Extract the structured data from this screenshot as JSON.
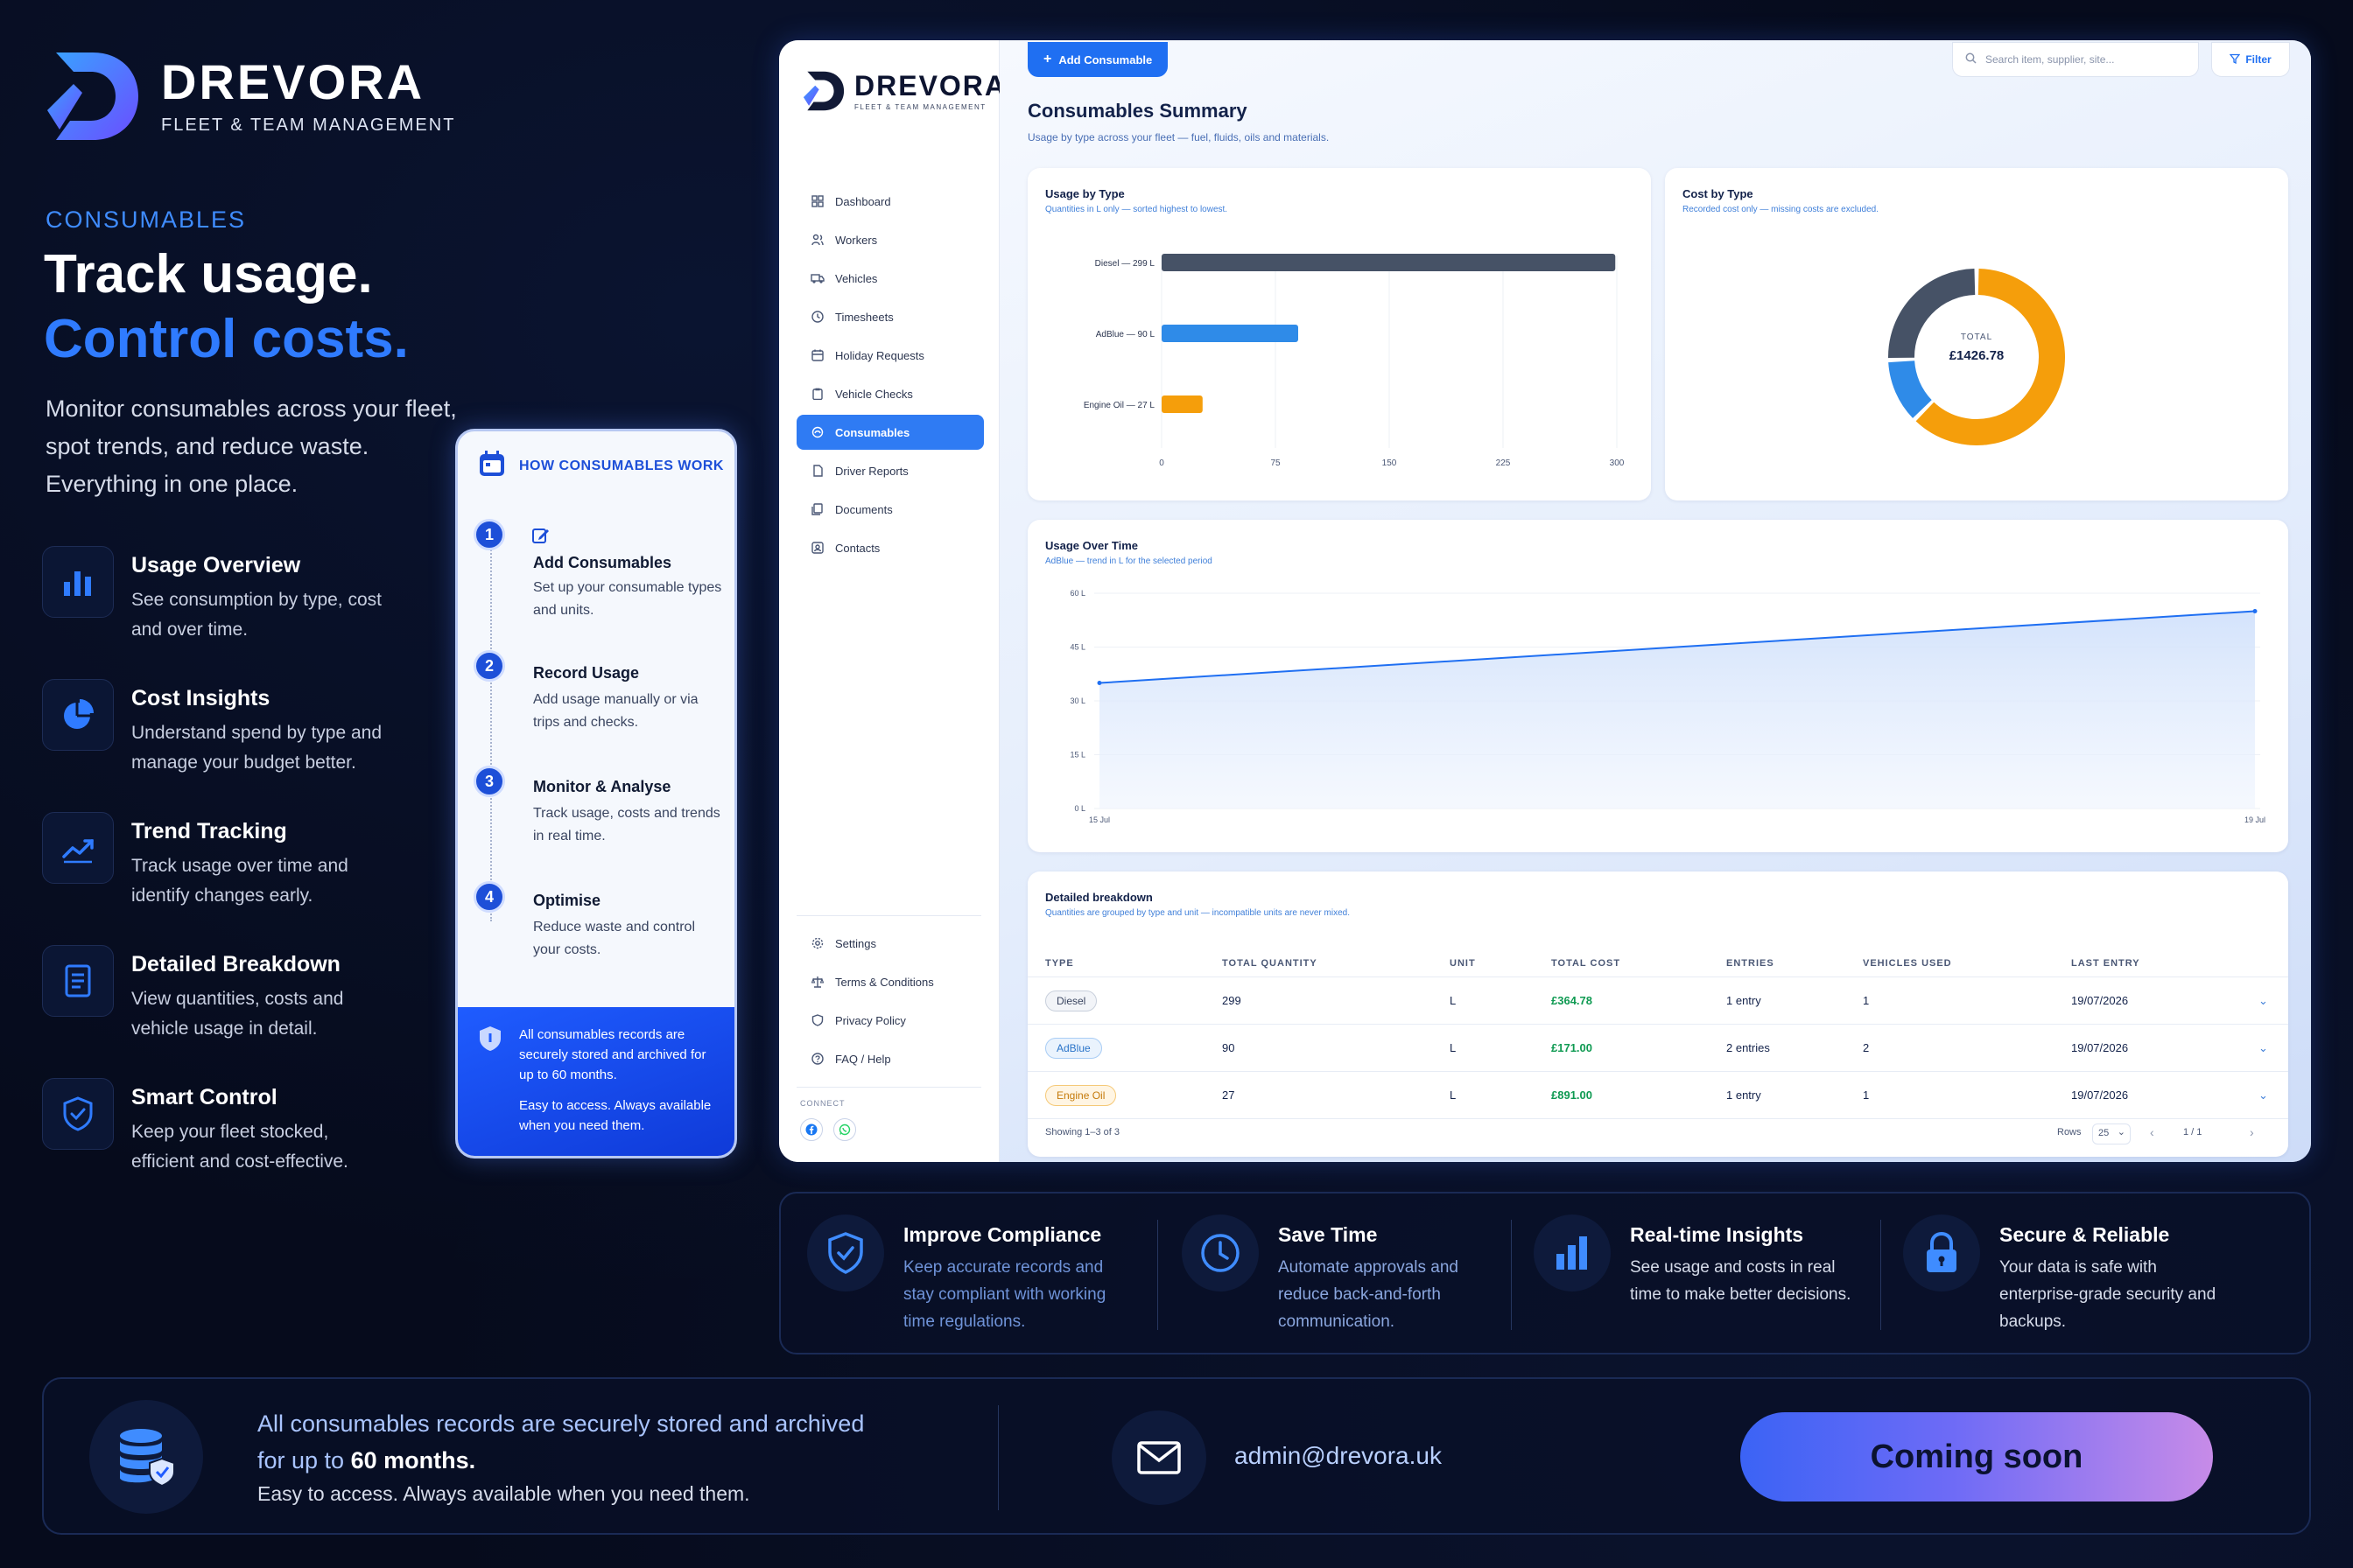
{
  "brand": {
    "name": "DREVORA",
    "tagline": "FLEET & TEAM MANAGEMENT"
  },
  "hero": {
    "eyebrow": "CONSUMABLES",
    "line1": "Track usage.",
    "line2": "Control costs.",
    "description": "Monitor consumables across your fleet, spot trends, and reduce waste. Everything in one place."
  },
  "features": [
    {
      "icon": "bar-chart-icon",
      "title": "Usage Overview",
      "desc": "See consumption by type, cost and over time."
    },
    {
      "icon": "pie-chart-icon",
      "title": "Cost Insights",
      "desc": "Understand spend by type and manage your budget better."
    },
    {
      "icon": "trend-line-icon",
      "title": "Trend Tracking",
      "desc": "Track usage over time and identify changes early."
    },
    {
      "icon": "document-list-icon",
      "title": "Detailed Breakdown",
      "desc": "View quantities, costs and vehicle usage in detail."
    },
    {
      "icon": "shield-check-icon",
      "title": "Smart Control",
      "desc": "Keep your fleet stocked, efficient and cost-effective."
    }
  ],
  "how": {
    "title": "HOW CONSUMABLES WORK",
    "steps": [
      {
        "num": "1",
        "title": "Add Consumables",
        "desc": "Set up your consumable types and units."
      },
      {
        "num": "2",
        "title": "Record Usage",
        "desc": "Add usage manually or via trips and checks."
      },
      {
        "num": "3",
        "title": "Monitor & Analyse",
        "desc": "Track usage, costs and trends in real time."
      },
      {
        "num": "4",
        "title": "Optimise",
        "desc": "Reduce waste and control your costs."
      }
    ],
    "footer_line1": "All consumables records are securely stored and archived for up to 60 months.",
    "footer_line2": "Easy to access. Always available when you need them."
  },
  "app": {
    "sidebar": {
      "brand": "DREVORA",
      "tagline": "FLEET & TEAM MANAGEMENT",
      "items": [
        {
          "label": "Dashboard",
          "icon": "grid-icon"
        },
        {
          "label": "Workers",
          "icon": "users-icon"
        },
        {
          "label": "Vehicles",
          "icon": "truck-icon"
        },
        {
          "label": "Timesheets",
          "icon": "clock-icon"
        },
        {
          "label": "Holiday Requests",
          "icon": "calendar-icon"
        },
        {
          "label": "Vehicle Checks",
          "icon": "clipboard-icon"
        },
        {
          "label": "Consumables",
          "icon": "droplet-icon",
          "active": true
        },
        {
          "label": "Driver Reports",
          "icon": "file-icon"
        },
        {
          "label": "Documents",
          "icon": "folder-icon"
        },
        {
          "label": "Contacts",
          "icon": "contact-icon"
        }
      ],
      "bottom_items": [
        {
          "label": "Settings",
          "icon": "gear-icon"
        },
        {
          "label": "Terms & Conditions",
          "icon": "scale-icon"
        },
        {
          "label": "Privacy Policy",
          "icon": "shield-icon"
        },
        {
          "label": "FAQ / Help",
          "icon": "help-icon"
        }
      ],
      "connect": "CONNECT"
    },
    "toolbar": {
      "add_label": "Add Consumable",
      "search_placeholder": "Search item, supplier, site...",
      "filter_label": "Filter"
    },
    "page": {
      "title": "Consumables Summary",
      "subtitle": "Usage by type across your fleet — fuel, fluids, oils and materials."
    },
    "usage_by_type": {
      "title": "Usage by Type",
      "subtitle": "Quantities in L only — sorted highest to lowest."
    },
    "cost_by_type": {
      "title": "Cost by Type",
      "subtitle": "Recorded cost only — missing costs are excluded.",
      "total_label": "TOTAL",
      "total_value": "£1426.78"
    },
    "usage_over_time": {
      "title": "Usage Over Time",
      "subtitle": "AdBlue — trend in L for the selected period"
    },
    "breakdown": {
      "title": "Detailed breakdown",
      "subtitle": "Quantities are grouped by type and unit — incompatible units are never mixed.",
      "columns": [
        "TYPE",
        "TOTAL QUANTITY",
        "UNIT",
        "TOTAL COST",
        "ENTRIES",
        "VEHICLES USED",
        "LAST ENTRY"
      ],
      "rows": [
        {
          "type": "Diesel",
          "qty": "299",
          "unit": "L",
          "cost": "£364.78",
          "entries": "1 entry",
          "vehicles": "1",
          "last": "19/07/2026"
        },
        {
          "type": "AdBlue",
          "qty": "90",
          "unit": "L",
          "cost": "£171.00",
          "entries": "2 entries",
          "vehicles": "2",
          "last": "19/07/2026"
        },
        {
          "type": "Engine Oil",
          "qty": "27",
          "unit": "L",
          "cost": "£891.00",
          "entries": "1 entry",
          "vehicles": "1",
          "last": "19/07/2026"
        }
      ],
      "showing": "Showing 1–3 of 3",
      "rows_label": "Rows",
      "rows_value": "25",
      "page_indicator": "1 / 1"
    }
  },
  "chart_data": [
    {
      "type": "bar",
      "title": "Usage by Type",
      "orientation": "horizontal",
      "categories": [
        "Diesel — 299 L",
        "AdBlue — 90 L",
        "Engine Oil — 27 L"
      ],
      "values": [
        299,
        90,
        27
      ],
      "colors": [
        "#465266",
        "#2f8be8",
        "#f59e0b"
      ],
      "ticks": [
        "0",
        "75",
        "150",
        "225",
        "300"
      ],
      "xlim": [
        0,
        300
      ]
    },
    {
      "type": "pie",
      "title": "Cost by Type",
      "donut": true,
      "labels": [
        "Engine Oil",
        "AdBlue",
        "Diesel"
      ],
      "values": [
        891.0,
        171.0,
        364.78
      ],
      "colors": [
        "#f59e0b",
        "#2f8be8",
        "#465266"
      ]
    },
    {
      "type": "area",
      "title": "Usage Over Time",
      "x": [
        "15 Jul",
        "19 Jul"
      ],
      "y": [
        35,
        55
      ],
      "y_ticks": [
        "60 L",
        "45 L",
        "30 L",
        "15 L",
        "0 L"
      ],
      "ylim": [
        0,
        60
      ],
      "color": "#1f6ff2"
    }
  ],
  "benefits": [
    {
      "icon": "shield-check-icon",
      "title": "Improve Compliance",
      "desc": "Keep accurate records and stay compliant with working time regulations.",
      "desc_color": "#6f93d8"
    },
    {
      "icon": "clock-icon",
      "title": "Save Time",
      "desc": "Automate approvals and reduce back-and-forth communication.",
      "desc_color": "#8aa6de"
    },
    {
      "icon": "bar-chart-icon",
      "title": "Real-time Insights",
      "desc": "See usage and costs in real time to make better decisions.",
      "desc_color": "#d6dcea"
    },
    {
      "icon": "lock-icon",
      "title": "Secure & Reliable",
      "desc": "Your data is safe with enterprise-grade security and backups.",
      "desc_color": "#d6dcea"
    }
  ],
  "footer": {
    "line1a": "All consumables records are securely stored and archived",
    "line1b_pre": "for up to",
    "line1b_bold": "60 months.",
    "line2": "Easy to access. Always available when you need them.",
    "email": "admin@drevora.uk",
    "cta": "Coming soon"
  }
}
